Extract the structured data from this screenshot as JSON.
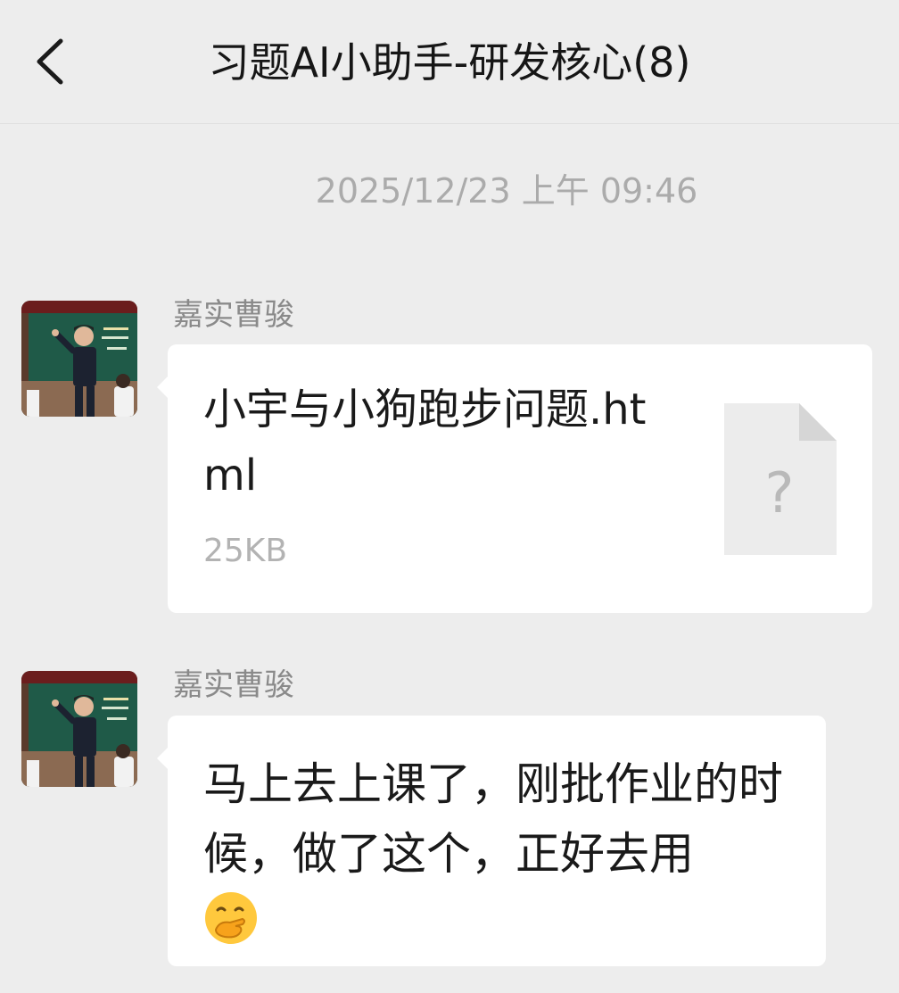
{
  "header": {
    "back_icon": "chevron-left-icon",
    "title": "习题AI小助手-研发核心(8)"
  },
  "timestamp": "2025/12/23 上午 09:46",
  "messages": [
    {
      "sender": "嘉实曹骏",
      "type": "file",
      "file_name": "小宇与小狗跑步问题.html",
      "file_size": "25KB",
      "file_icon": "unknown-file-icon",
      "file_icon_glyph": "?"
    },
    {
      "sender": "嘉实曹骏",
      "type": "text",
      "text": "马上去上课了，刚批作业的时候，做了这个，正好去用",
      "emoji": "face-with-hand-over-mouth-emoji"
    }
  ],
  "colors": {
    "background": "#ededed",
    "bubble": "#ffffff",
    "secondary_text": "#8a8a8a",
    "timestamp_text": "#ababab"
  }
}
